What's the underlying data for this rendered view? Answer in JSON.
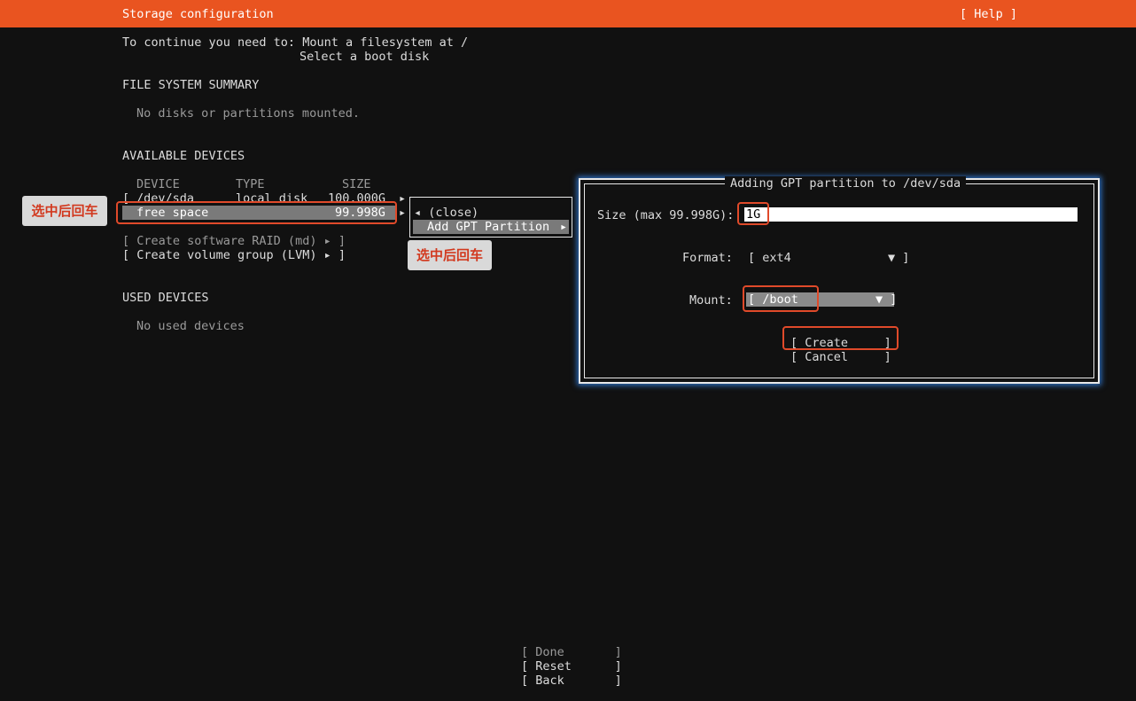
{
  "header": {
    "title": "Storage configuration",
    "help": "[ Help ]"
  },
  "intro": {
    "line1": "To continue you need to: Mount a filesystem at /",
    "line2": "Select a boot disk"
  },
  "fs_summary": {
    "heading": "FILE SYSTEM SUMMARY",
    "empty": "No disks or partitions mounted."
  },
  "available": {
    "heading": "AVAILABLE DEVICES",
    "col_device": "DEVICE",
    "col_type": "TYPE",
    "col_size": "SIZE",
    "disk": {
      "bracket": "[",
      "name": "/dev/sda",
      "type": "local disk",
      "size": "100.000G",
      "arrow": "▸"
    },
    "free": {
      "name": "free space",
      "size": "99.998G",
      "arrow": "▸"
    },
    "raid": "[ Create software RAID (md) ▸ ]",
    "lvm": "[ Create volume group (LVM) ▸ ]"
  },
  "used": {
    "heading": "USED DEVICES",
    "empty": "No used devices"
  },
  "menu": {
    "close": "◂ (close)",
    "add_gpt": "Add GPT Partition",
    "add_arrow": "▸"
  },
  "dialog": {
    "title": "Adding GPT partition to /dev/sda",
    "size_label": "Size (max 99.998G):",
    "size_value": "1G",
    "format_label": "Format:",
    "format_value": "[ ext4",
    "format_arrow": "▼ ]",
    "mount_label": "Mount:",
    "mount_value": "[ /boot",
    "mount_arrow": "▼ ]",
    "create": "[ Create     ]",
    "cancel": "[ Cancel     ]"
  },
  "footer": {
    "done": "[ Done       ]",
    "reset": "[ Reset      ]",
    "back": "[ Back       ]"
  },
  "annotations": {
    "tag1": "选中后回车",
    "tag2": "选中后回车"
  },
  "colors": {
    "accent": "#e95420",
    "highlight": "#e04a2a",
    "background": "#111111"
  }
}
